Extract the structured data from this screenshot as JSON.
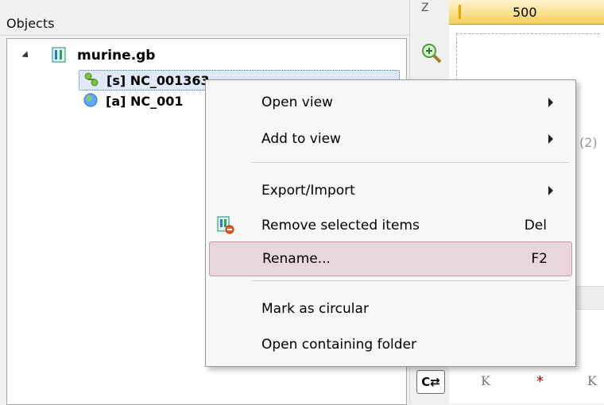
{
  "objects_panel": {
    "title": "Objects",
    "root": {
      "label": "murine.gb"
    },
    "children": [
      {
        "label": "[s] NC_001363"
      },
      {
        "label": "[a] NC_001"
      }
    ]
  },
  "ruler": {
    "value": "500"
  },
  "sequence_view": {
    "gray_label": "(2)",
    "bottom_chars": [
      "K",
      "*",
      "K"
    ]
  },
  "toolbar": {
    "top_button": "Z",
    "bottom_button": "C⇄"
  },
  "context_menu": {
    "items": [
      {
        "label": "Open view",
        "submenu": true
      },
      {
        "label": "Add to view",
        "submenu": true
      },
      {
        "label": "Export/Import",
        "submenu": true
      },
      {
        "label": "Remove selected items",
        "shortcut": "Del",
        "icon": "remove-items-icon"
      },
      {
        "label": "Rename...",
        "shortcut": "F2",
        "highlighted": true
      },
      {
        "label": "Mark as circular"
      },
      {
        "label": "Open containing folder"
      }
    ]
  },
  "colors": {
    "highlight": "#e8d6da",
    "ruler": "#f6d05e"
  }
}
